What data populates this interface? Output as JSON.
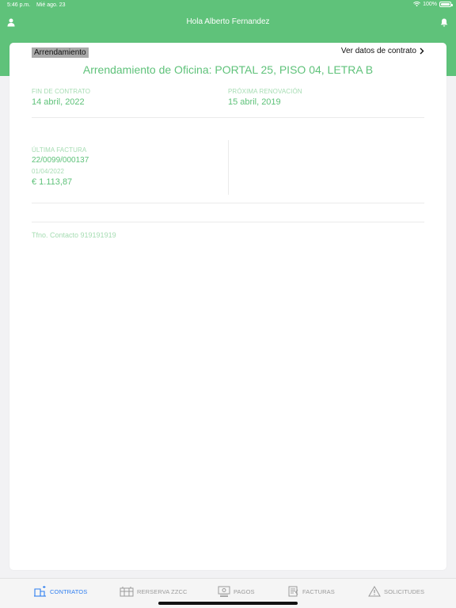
{
  "status_bar": {
    "time": "5:46 p.m.",
    "date": "Mié ago. 23",
    "battery": "100%"
  },
  "header": {
    "title": "Hola Alberto Fernandez",
    "user_icon": "person-icon",
    "bell_icon": "bell-icon",
    "color": "#5fc27a"
  },
  "card": {
    "badge": "Arrendamiento",
    "contract_link": "Ver datos de contrato",
    "title": "Arrendamiento de Oficina: PORTAL 25, PISO 04, LETRA B",
    "end_label": "FIN DE CONTRATO",
    "end_value": "14 abril, 2022",
    "renewal_label": "PRÓXIMA RENOVACIÓN",
    "renewal_value": "15 abril, 2019",
    "invoice_label": "ÚLTIMA FACTURA",
    "invoice_number": "22/0099/000137",
    "invoice_date": "01/04/2022",
    "invoice_amount": "€ 1.113,87",
    "phone": "Tfno. Contacto 919191919"
  },
  "tabbar": {
    "tabs": [
      {
        "label": "CONTRATOS",
        "icon": "contracts-icon",
        "active": true
      },
      {
        "label": "RERSERVA ZZCC",
        "icon": "booking-icon",
        "active": false
      },
      {
        "label": "PAGOS",
        "icon": "payments-icon",
        "active": false
      },
      {
        "label": "FACTURAS",
        "icon": "invoices-icon",
        "active": false
      },
      {
        "label": "SOLICITUDES",
        "icon": "warning-icon",
        "active": false
      }
    ],
    "active_color": "#2e7ef0"
  }
}
